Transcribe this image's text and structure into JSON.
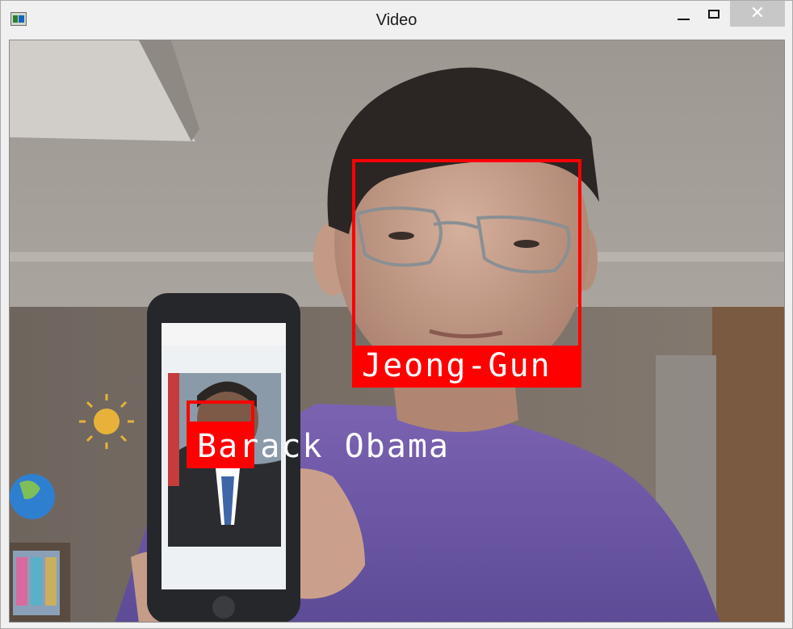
{
  "window": {
    "title": "Video",
    "icon": "app-icon",
    "controls": {
      "minimize": "minimize-icon",
      "maximize": "maximize-icon",
      "close": "close-icon",
      "close_glyph": "✕"
    }
  },
  "video": {
    "detections": [
      {
        "name": "Jeong-Gun",
        "box_color": "#ff0000"
      },
      {
        "name": "Barack Obama",
        "box_color": "#ff0000"
      }
    ]
  }
}
